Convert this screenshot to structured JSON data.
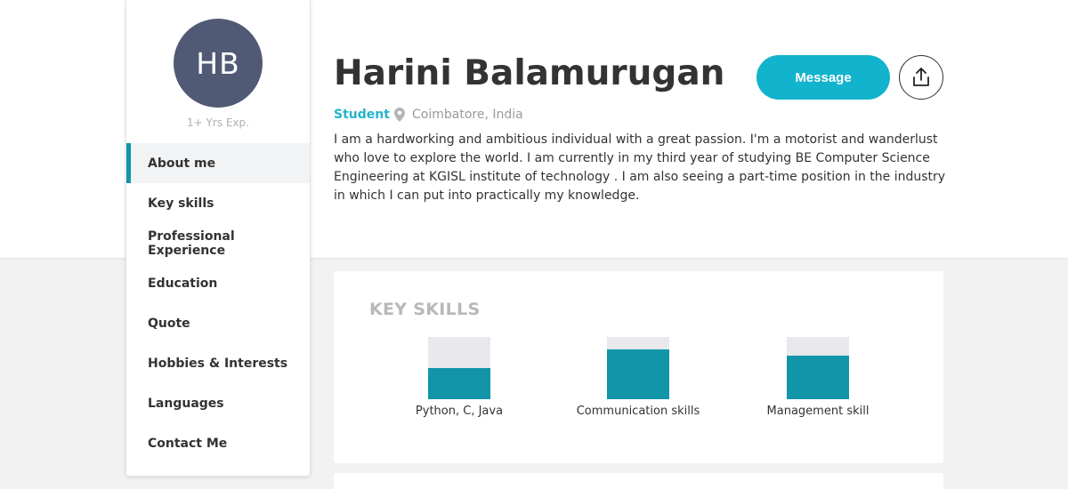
{
  "profile": {
    "initials": "HB",
    "experience": "1+ Yrs Exp.",
    "name": "Harini Balamurugan",
    "role": "Student",
    "location": "Coimbatore, India",
    "about": "I am a hardworking and ambitious individual with a great passion. I'm a motorist and wanderlust who love to explore the world. I am currently in my third year of studying BE Computer Science Engineering at KGISL institute of technology . I am also seeing a part-time position in the industry in which I can put into practically my knowledge."
  },
  "actions": {
    "message_label": "Message",
    "share_icon": "share-upload-icon"
  },
  "nav": {
    "items": [
      {
        "label": "About me",
        "active": true
      },
      {
        "label": "Key skills",
        "active": false
      },
      {
        "label": "Professional Experience",
        "active": false
      },
      {
        "label": "Education",
        "active": false
      },
      {
        "label": "Quote",
        "active": false
      },
      {
        "label": "Hobbies & Interests",
        "active": false
      },
      {
        "label": "Languages",
        "active": false
      },
      {
        "label": "Contact Me",
        "active": false
      }
    ]
  },
  "key_skills": {
    "title": "KEY SKILLS",
    "skills": [
      {
        "label": "Python, C, Java",
        "level": 0.5
      },
      {
        "label": "Communication skills",
        "level": 0.8
      },
      {
        "label": "Management skill",
        "level": 0.7
      }
    ]
  },
  "colors": {
    "accent": "#12b3cc",
    "bar_fill": "#1295a8",
    "bar_track": "#e9e9ed",
    "avatar_bg": "#515a74"
  },
  "icons": {
    "location": "map-pin-icon"
  }
}
